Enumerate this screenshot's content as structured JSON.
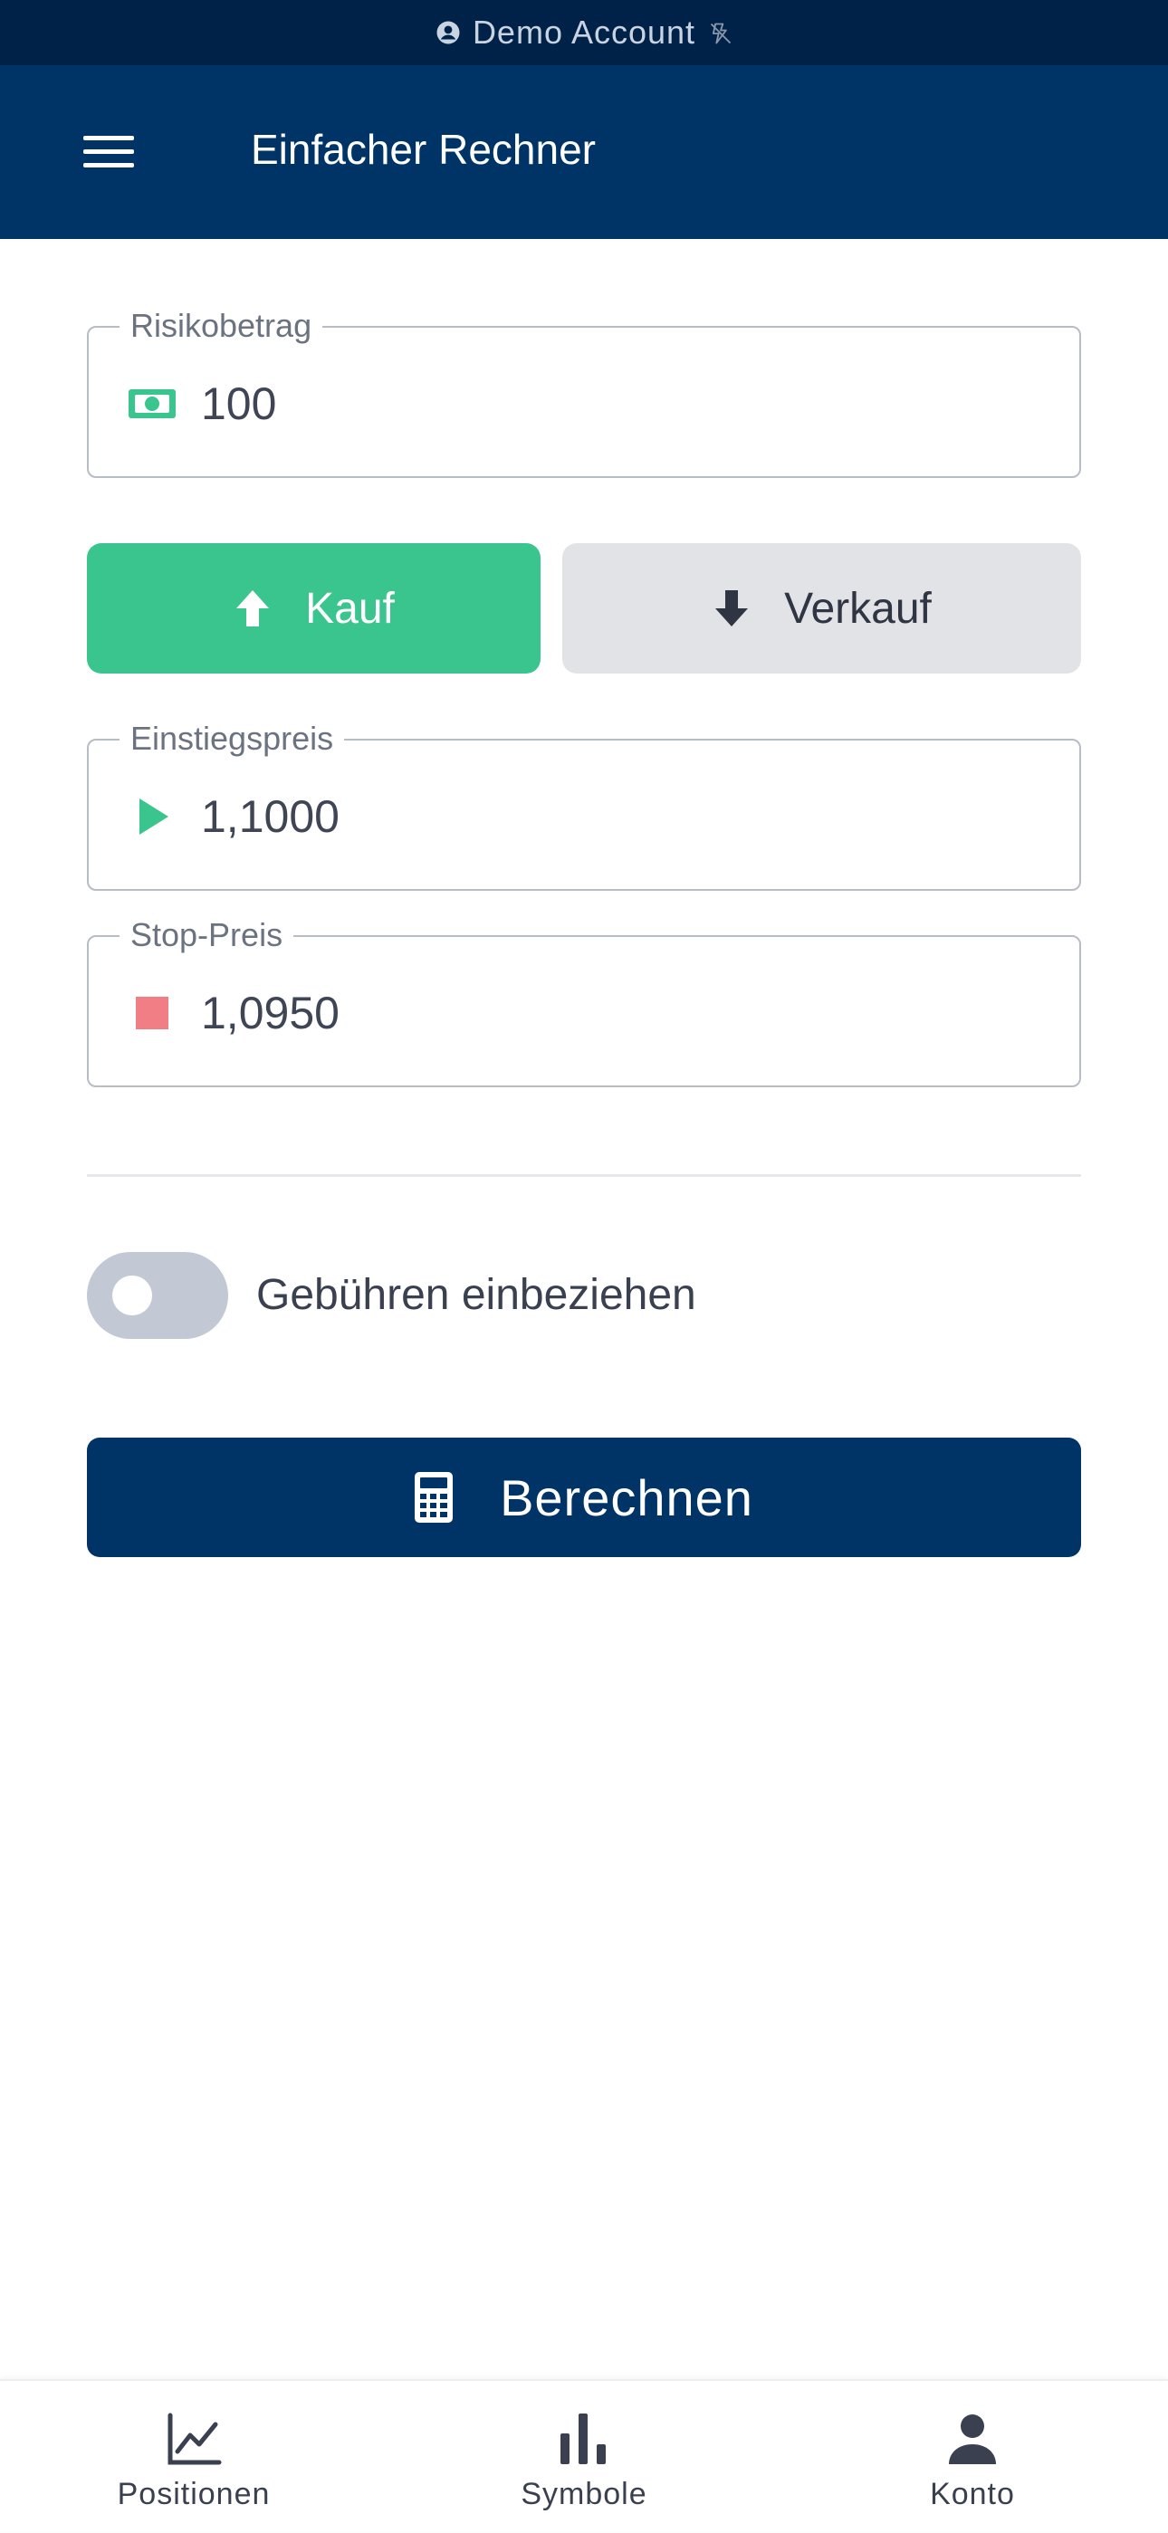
{
  "status_bar": {
    "text": "Demo Account",
    "left_icon": "account-circle-icon",
    "right_icon": "signal-off-icon"
  },
  "app_bar": {
    "menu_icon": "hamburger-menu-icon",
    "title": "Einfacher Rechner"
  },
  "form": {
    "risk_amount": {
      "label": "Risikobetrag",
      "value": "100",
      "icon": "cash-icon"
    },
    "side": {
      "buy_label": "Kauf",
      "sell_label": "Verkauf",
      "selected": "Kauf"
    },
    "entry_price": {
      "label": "Einstiegspreis",
      "value": "1,1000",
      "icon": "play-triangle-icon"
    },
    "stop_price": {
      "label": "Stop-Preis",
      "value": "1,0950",
      "icon": "stop-square-icon"
    },
    "fees_toggle": {
      "label": "Gebühren einbeziehen",
      "on": false
    },
    "calculate_label": "Berechnen"
  },
  "bottom_nav": {
    "items": [
      {
        "label": "Positionen",
        "icon": "line-chart-icon"
      },
      {
        "label": "Symbole",
        "icon": "bar-chart-icon"
      },
      {
        "label": "Konto",
        "icon": "person-icon"
      }
    ]
  },
  "colors": {
    "primary": "#003366",
    "status_bar": "#002248",
    "buy": "#3ac48e",
    "sell_bg": "#e2e3e6",
    "stop": "#f07e84",
    "entry": "#3ac48e"
  }
}
